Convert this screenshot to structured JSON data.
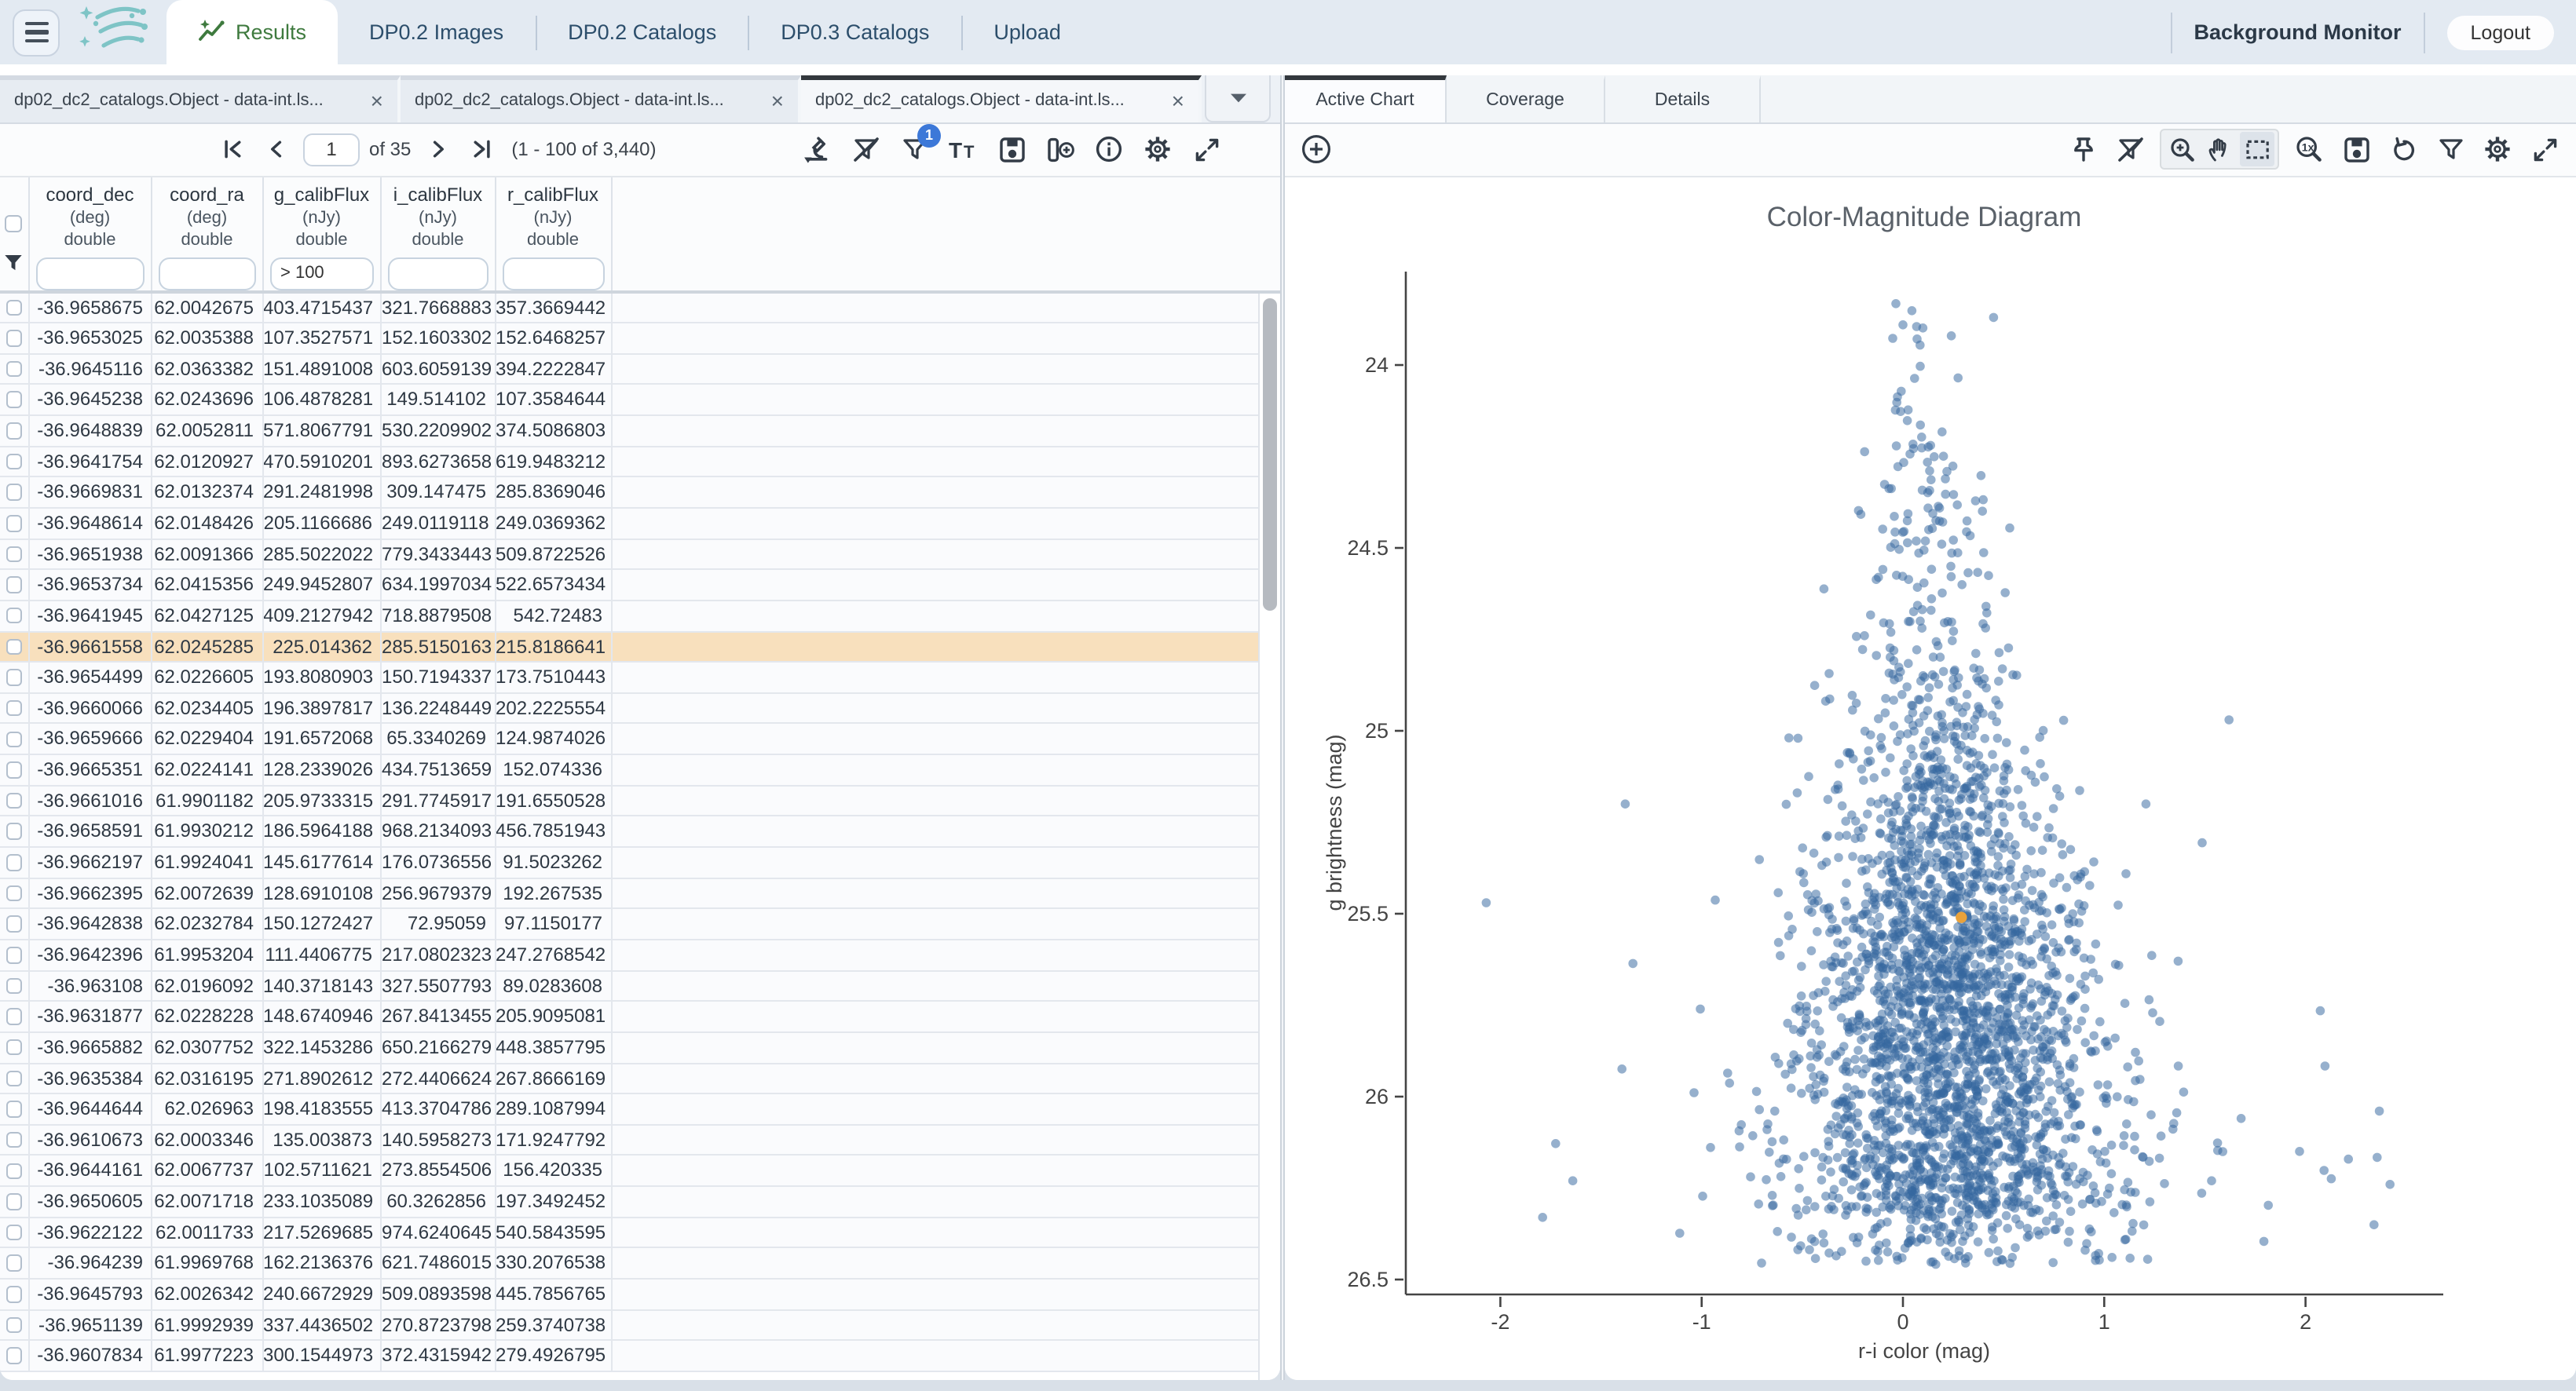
{
  "topbar": {
    "tabs": [
      {
        "label": "Results",
        "active": true
      },
      {
        "label": "DP0.2 Images",
        "active": false
      },
      {
        "label": "DP0.2 Catalogs",
        "active": false
      },
      {
        "label": "DP0.3 Catalogs",
        "active": false
      },
      {
        "label": "Upload",
        "active": false
      }
    ],
    "background_monitor_label": "Background Monitor",
    "logout_label": "Logout"
  },
  "left_panel": {
    "doc_tabs": [
      {
        "label": "dp02_dc2_catalogs.Object - data-int.ls...",
        "active": false
      },
      {
        "label": "dp02_dc2_catalogs.Object - data-int.ls...",
        "active": false
      },
      {
        "label": "dp02_dc2_catalogs.Object - data-int.ls...",
        "active": true
      }
    ],
    "pagination": {
      "page": "1",
      "of_label": "of 35",
      "range_label": "(1 - 100 of 3,440)"
    },
    "toolbar_icons": [
      "search-scope",
      "filter-clear",
      "filter-applied",
      "text-options",
      "save",
      "add-column",
      "info",
      "settings",
      "expand"
    ],
    "filter_badge": "1",
    "table": {
      "columns": [
        {
          "name": "coord_dec",
          "unit": "(deg)",
          "type": "double",
          "filter": "",
          "width": 78.5
        },
        {
          "name": "coord_ra",
          "unit": "(deg)",
          "type": "double",
          "filter": "",
          "width": 70.5
        },
        {
          "name": "g_calibFlux",
          "unit": "(nJy)",
          "type": "double",
          "filter": "> 100",
          "width": 75.5
        },
        {
          "name": "i_calibFlux",
          "unit": "(nJy)",
          "type": "double",
          "filter": "",
          "width": 72.5
        },
        {
          "name": "r_calibFlux",
          "unit": "(nJy)",
          "type": "double",
          "filter": "",
          "width": 74
        }
      ],
      "highlighted_row_index": 11,
      "rows": [
        [
          "-36.9658675",
          "62.0042675",
          "403.4715437",
          "321.7668883",
          "357.3669442"
        ],
        [
          "-36.9653025",
          "62.0035388",
          "107.3527571",
          "152.1603302",
          "152.6468257"
        ],
        [
          "-36.9645116",
          "62.0363382",
          "151.4891008",
          "603.6059139",
          "394.2222847"
        ],
        [
          "-36.9645238",
          "62.0243696",
          "106.4878281",
          "149.514102",
          "107.3584644"
        ],
        [
          "-36.9648839",
          "62.0052811",
          "571.8067791",
          "530.2209902",
          "374.5086803"
        ],
        [
          "-36.9641754",
          "62.0120927",
          "470.5910201",
          "893.6273658",
          "619.9483212"
        ],
        [
          "-36.9669831",
          "62.0132374",
          "291.2481998",
          "309.147475",
          "285.8369046"
        ],
        [
          "-36.9648614",
          "62.0148426",
          "205.1166686",
          "249.0119118",
          "249.0369362"
        ],
        [
          "-36.9651938",
          "62.0091366",
          "285.5022022",
          "779.3433443",
          "509.8722526"
        ],
        [
          "-36.9653734",
          "62.0415356",
          "249.9452807",
          "634.1997034",
          "522.6573434"
        ],
        [
          "-36.9641945",
          "62.0427125",
          "409.2127942",
          "718.8879508",
          "542.72483"
        ],
        [
          "-36.9661558",
          "62.0245285",
          "225.014362",
          "285.5150163",
          "215.8186641"
        ],
        [
          "-36.9654499",
          "62.0226605",
          "193.8080903",
          "150.7194337",
          "173.7510443"
        ],
        [
          "-36.9660066",
          "62.0234405",
          "196.3897817",
          "136.2248449",
          "202.2225554"
        ],
        [
          "-36.9659666",
          "62.0229404",
          "191.6572068",
          "65.3340269",
          "124.9874026"
        ],
        [
          "-36.9665351",
          "62.0224141",
          "128.2339026",
          "434.7513659",
          "152.074336"
        ],
        [
          "-36.9661016",
          "61.9901182",
          "205.9733315",
          "291.7745917",
          "191.6550528"
        ],
        [
          "-36.9658591",
          "61.9930212",
          "186.5964188",
          "968.2134093",
          "456.7851943"
        ],
        [
          "-36.9662197",
          "61.9924041",
          "145.6177614",
          "176.0736556",
          "91.5023262"
        ],
        [
          "-36.9662395",
          "62.0072639",
          "128.6910108",
          "256.9679379",
          "192.267535"
        ],
        [
          "-36.9642838",
          "62.0232784",
          "150.1272427",
          "72.95059",
          "97.1150177"
        ],
        [
          "-36.9642396",
          "61.9953204",
          "111.4406775",
          "217.0802323",
          "247.2768542"
        ],
        [
          "-36.963108",
          "62.0196092",
          "140.3718143",
          "327.5507793",
          "89.0283608"
        ],
        [
          "-36.9631877",
          "62.0228228",
          "148.6740946",
          "267.8413455",
          "205.9095081"
        ],
        [
          "-36.9665882",
          "62.0307752",
          "322.1453286",
          "650.2166279",
          "448.3857795"
        ],
        [
          "-36.9635384",
          "62.0316195",
          "271.8902612",
          "272.4406624",
          "267.8666169"
        ],
        [
          "-36.9644644",
          "62.026963",
          "198.4183555",
          "413.3704786",
          "289.1087994"
        ],
        [
          "-36.9610673",
          "62.0003346",
          "135.003873",
          "140.5958273",
          "171.9247792"
        ],
        [
          "-36.9644161",
          "62.0067737",
          "102.5711621",
          "273.8554506",
          "156.420335"
        ],
        [
          "-36.9650605",
          "62.0071718",
          "233.1035089",
          "60.3262856",
          "197.3492452"
        ],
        [
          "-36.9622122",
          "62.0011733",
          "217.5269685",
          "974.6240645",
          "540.5843595"
        ],
        [
          "-36.964239",
          "61.9969768",
          "162.2136376",
          "621.7486015",
          "330.2076538"
        ],
        [
          "-36.9645793",
          "62.0026342",
          "240.6672929",
          "509.0893598",
          "445.7856765"
        ],
        [
          "-36.9651139",
          "61.9992939",
          "337.4436502",
          "270.8723798",
          "259.3740738"
        ],
        [
          "-36.9607834",
          "61.9977223",
          "300.1544973",
          "372.4315942",
          "279.4926795"
        ]
      ]
    }
  },
  "right_panel": {
    "tabs": [
      {
        "label": "Active Chart",
        "active": true
      },
      {
        "label": "Coverage",
        "active": false
      },
      {
        "label": "Details",
        "active": false
      }
    ],
    "toolbar_icons": [
      "pin",
      "filter-clear",
      "zoom-in",
      "pan",
      "select-rect",
      "zoom-original",
      "save",
      "restore",
      "filter",
      "settings",
      "expand"
    ],
    "selected_tool": "select-rect"
  },
  "chart_data": {
    "type": "scatter",
    "title": "Color-Magnitude Diagram",
    "xlabel": "r-i color (mag)",
    "ylabel": "g brightness (mag)",
    "x_ticks": [
      -2,
      -1,
      0,
      1,
      2
    ],
    "y_ticks": [
      24,
      24.5,
      25,
      25.5,
      26,
      26.5
    ],
    "y_axis_inverted": true,
    "x_range": [
      -2.47,
      2.68
    ],
    "y_range": [
      23.74,
      26.54
    ],
    "grid": false,
    "legend": "none",
    "marker_color": "#35689f",
    "marker_opacity": 0.52,
    "n_points": 2900,
    "distribution": {
      "seed": 42,
      "mix_frac": 0.86,
      "y_mean1": 26.0,
      "y_sd1": 0.5,
      "y_mean2": 25.3,
      "y_sd2": 0.78,
      "y_min": 23.8,
      "y_max": 26.46,
      "bottom_thin_start": 26.32,
      "bottom_thin_keep": 0.55,
      "x_center_base": 0.05,
      "x_center_slope": 0.11,
      "x_sd_base": 0.085,
      "x_sd_slope": 0.15,
      "heavy_tail_frac": 0.05,
      "heavy_tail_mult": 2.2
    },
    "outliers": [
      [
        -2.07,
        25.47
      ],
      [
        -1.79,
        26.33
      ],
      [
        -1.64,
        26.23
      ],
      [
        1.97,
        26.15
      ],
      [
        2.34,
        26.35
      ],
      [
        2.42,
        26.24
      ],
      [
        0.0,
        23.89
      ],
      [
        0.24,
        23.92
      ],
      [
        0.45,
        23.87
      ],
      [
        1.62,
        24.97
      ],
      [
        -1.38,
        25.2
      ]
    ],
    "selected_point": {
      "x": 0.29,
      "y": 25.51,
      "color": "#e9a23b"
    }
  }
}
